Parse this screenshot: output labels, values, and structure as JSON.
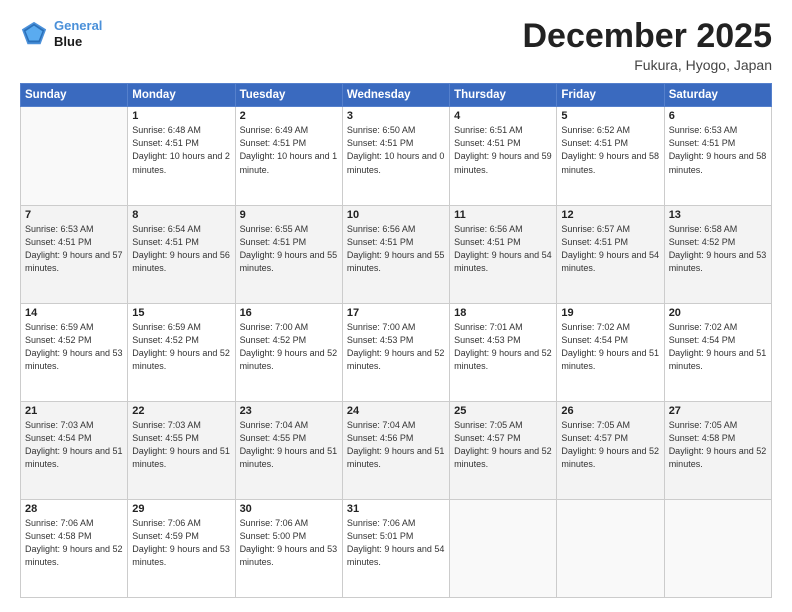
{
  "header": {
    "logo_line1": "General",
    "logo_line2": "Blue",
    "title": "December 2025",
    "subtitle": "Fukura, Hyogo, Japan"
  },
  "days_of_week": [
    "Sunday",
    "Monday",
    "Tuesday",
    "Wednesday",
    "Thursday",
    "Friday",
    "Saturday"
  ],
  "weeks": [
    {
      "shaded": false,
      "days": [
        {
          "num": "",
          "sunrise": "",
          "sunset": "",
          "daylight": ""
        },
        {
          "num": "1",
          "sunrise": "Sunrise: 6:48 AM",
          "sunset": "Sunset: 4:51 PM",
          "daylight": "Daylight: 10 hours and 2 minutes."
        },
        {
          "num": "2",
          "sunrise": "Sunrise: 6:49 AM",
          "sunset": "Sunset: 4:51 PM",
          "daylight": "Daylight: 10 hours and 1 minute."
        },
        {
          "num": "3",
          "sunrise": "Sunrise: 6:50 AM",
          "sunset": "Sunset: 4:51 PM",
          "daylight": "Daylight: 10 hours and 0 minutes."
        },
        {
          "num": "4",
          "sunrise": "Sunrise: 6:51 AM",
          "sunset": "Sunset: 4:51 PM",
          "daylight": "Daylight: 9 hours and 59 minutes."
        },
        {
          "num": "5",
          "sunrise": "Sunrise: 6:52 AM",
          "sunset": "Sunset: 4:51 PM",
          "daylight": "Daylight: 9 hours and 58 minutes."
        },
        {
          "num": "6",
          "sunrise": "Sunrise: 6:53 AM",
          "sunset": "Sunset: 4:51 PM",
          "daylight": "Daylight: 9 hours and 58 minutes."
        }
      ]
    },
    {
      "shaded": true,
      "days": [
        {
          "num": "7",
          "sunrise": "Sunrise: 6:53 AM",
          "sunset": "Sunset: 4:51 PM",
          "daylight": "Daylight: 9 hours and 57 minutes."
        },
        {
          "num": "8",
          "sunrise": "Sunrise: 6:54 AM",
          "sunset": "Sunset: 4:51 PM",
          "daylight": "Daylight: 9 hours and 56 minutes."
        },
        {
          "num": "9",
          "sunrise": "Sunrise: 6:55 AM",
          "sunset": "Sunset: 4:51 PM",
          "daylight": "Daylight: 9 hours and 55 minutes."
        },
        {
          "num": "10",
          "sunrise": "Sunrise: 6:56 AM",
          "sunset": "Sunset: 4:51 PM",
          "daylight": "Daylight: 9 hours and 55 minutes."
        },
        {
          "num": "11",
          "sunrise": "Sunrise: 6:56 AM",
          "sunset": "Sunset: 4:51 PM",
          "daylight": "Daylight: 9 hours and 54 minutes."
        },
        {
          "num": "12",
          "sunrise": "Sunrise: 6:57 AM",
          "sunset": "Sunset: 4:51 PM",
          "daylight": "Daylight: 9 hours and 54 minutes."
        },
        {
          "num": "13",
          "sunrise": "Sunrise: 6:58 AM",
          "sunset": "Sunset: 4:52 PM",
          "daylight": "Daylight: 9 hours and 53 minutes."
        }
      ]
    },
    {
      "shaded": false,
      "days": [
        {
          "num": "14",
          "sunrise": "Sunrise: 6:59 AM",
          "sunset": "Sunset: 4:52 PM",
          "daylight": "Daylight: 9 hours and 53 minutes."
        },
        {
          "num": "15",
          "sunrise": "Sunrise: 6:59 AM",
          "sunset": "Sunset: 4:52 PM",
          "daylight": "Daylight: 9 hours and 52 minutes."
        },
        {
          "num": "16",
          "sunrise": "Sunrise: 7:00 AM",
          "sunset": "Sunset: 4:52 PM",
          "daylight": "Daylight: 9 hours and 52 minutes."
        },
        {
          "num": "17",
          "sunrise": "Sunrise: 7:00 AM",
          "sunset": "Sunset: 4:53 PM",
          "daylight": "Daylight: 9 hours and 52 minutes."
        },
        {
          "num": "18",
          "sunrise": "Sunrise: 7:01 AM",
          "sunset": "Sunset: 4:53 PM",
          "daylight": "Daylight: 9 hours and 52 minutes."
        },
        {
          "num": "19",
          "sunrise": "Sunrise: 7:02 AM",
          "sunset": "Sunset: 4:54 PM",
          "daylight": "Daylight: 9 hours and 51 minutes."
        },
        {
          "num": "20",
          "sunrise": "Sunrise: 7:02 AM",
          "sunset": "Sunset: 4:54 PM",
          "daylight": "Daylight: 9 hours and 51 minutes."
        }
      ]
    },
    {
      "shaded": true,
      "days": [
        {
          "num": "21",
          "sunrise": "Sunrise: 7:03 AM",
          "sunset": "Sunset: 4:54 PM",
          "daylight": "Daylight: 9 hours and 51 minutes."
        },
        {
          "num": "22",
          "sunrise": "Sunrise: 7:03 AM",
          "sunset": "Sunset: 4:55 PM",
          "daylight": "Daylight: 9 hours and 51 minutes."
        },
        {
          "num": "23",
          "sunrise": "Sunrise: 7:04 AM",
          "sunset": "Sunset: 4:55 PM",
          "daylight": "Daylight: 9 hours and 51 minutes."
        },
        {
          "num": "24",
          "sunrise": "Sunrise: 7:04 AM",
          "sunset": "Sunset: 4:56 PM",
          "daylight": "Daylight: 9 hours and 51 minutes."
        },
        {
          "num": "25",
          "sunrise": "Sunrise: 7:05 AM",
          "sunset": "Sunset: 4:57 PM",
          "daylight": "Daylight: 9 hours and 52 minutes."
        },
        {
          "num": "26",
          "sunrise": "Sunrise: 7:05 AM",
          "sunset": "Sunset: 4:57 PM",
          "daylight": "Daylight: 9 hours and 52 minutes."
        },
        {
          "num": "27",
          "sunrise": "Sunrise: 7:05 AM",
          "sunset": "Sunset: 4:58 PM",
          "daylight": "Daylight: 9 hours and 52 minutes."
        }
      ]
    },
    {
      "shaded": false,
      "days": [
        {
          "num": "28",
          "sunrise": "Sunrise: 7:06 AM",
          "sunset": "Sunset: 4:58 PM",
          "daylight": "Daylight: 9 hours and 52 minutes."
        },
        {
          "num": "29",
          "sunrise": "Sunrise: 7:06 AM",
          "sunset": "Sunset: 4:59 PM",
          "daylight": "Daylight: 9 hours and 53 minutes."
        },
        {
          "num": "30",
          "sunrise": "Sunrise: 7:06 AM",
          "sunset": "Sunset: 5:00 PM",
          "daylight": "Daylight: 9 hours and 53 minutes."
        },
        {
          "num": "31",
          "sunrise": "Sunrise: 7:06 AM",
          "sunset": "Sunset: 5:01 PM",
          "daylight": "Daylight: 9 hours and 54 minutes."
        },
        {
          "num": "",
          "sunrise": "",
          "sunset": "",
          "daylight": ""
        },
        {
          "num": "",
          "sunrise": "",
          "sunset": "",
          "daylight": ""
        },
        {
          "num": "",
          "sunrise": "",
          "sunset": "",
          "daylight": ""
        }
      ]
    }
  ]
}
